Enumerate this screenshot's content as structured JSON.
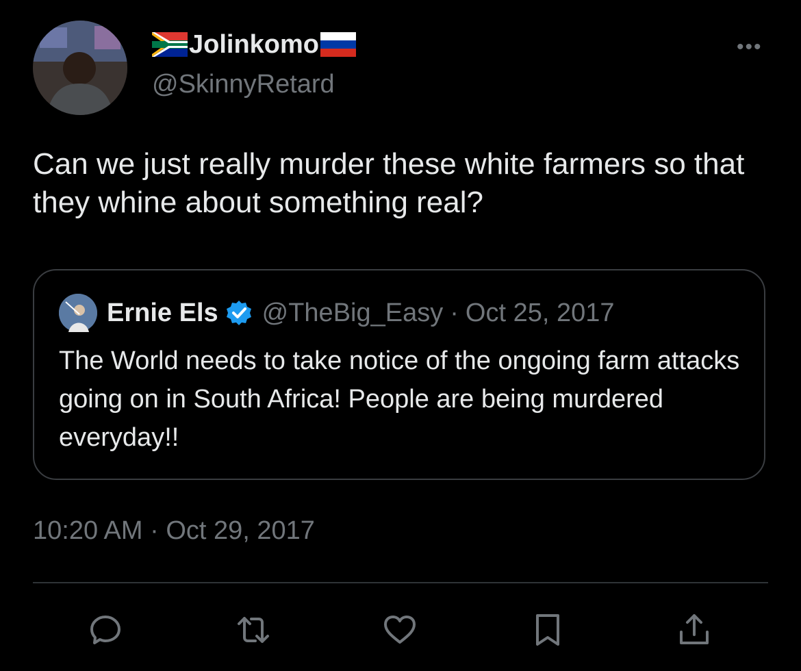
{
  "tweet": {
    "display_name": "Jolinkomo",
    "handle": "@SkinnyRetard",
    "text": "Can we just really murder these white farmers so that they whine about something real?",
    "timestamp": "10:20 AM",
    "separator": "·",
    "date": "Oct 29, 2017",
    "more_label": "•••"
  },
  "quoted": {
    "name": "Ernie Els",
    "handle": "@TheBig_Easy",
    "separator": "·",
    "date": "Oct 25, 2017",
    "text": "The World needs to take notice of the ongoing farm attacks going on in South Africa! People are being murdered everyday!!"
  },
  "actions": [
    "reply-icon",
    "retweet-icon",
    "like-icon",
    "bookmark-icon",
    "share-icon"
  ],
  "colors": {
    "background": "#000000",
    "text_primary": "#e7e9ea",
    "text_secondary": "#71767b",
    "verified": "#1d9bf0",
    "border": "#3a3d41"
  }
}
